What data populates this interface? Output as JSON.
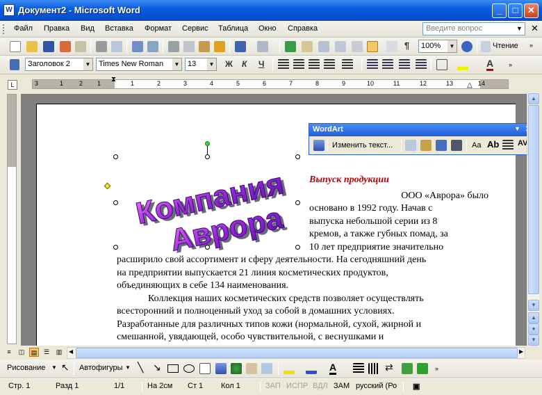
{
  "window": {
    "title": "Документ2 - Microsoft Word",
    "icon": "W"
  },
  "menu": {
    "items": [
      "Файл",
      "Правка",
      "Вид",
      "Вставка",
      "Формат",
      "Сервис",
      "Таблица",
      "Окно",
      "Справка"
    ],
    "ask_placeholder": "Введите вопрос"
  },
  "toolbar_standard": {
    "zoom": "100%",
    "read_label": "Чтение"
  },
  "toolbar_formatting": {
    "style": "Заголовок 2",
    "font": "Times New Roman",
    "size": "13",
    "bold": "Ж",
    "italic": "К",
    "underline": "Ч"
  },
  "ruler": {
    "marks": [
      "3",
      "1",
      "2",
      "1",
      "1",
      "2",
      "3",
      "4",
      "5",
      "6",
      "7",
      "8",
      "9",
      "10",
      "11",
      "12",
      "13",
      "14"
    ]
  },
  "wordart_toolbar": {
    "title": "WordArt",
    "edit_text": "Изменить текст..."
  },
  "wordart": {
    "line1": "Компания",
    "line2": "Аврора"
  },
  "document": {
    "heading": "Выпуск продукции",
    "para1_lines": [
      "ООО «Аврора» было",
      "основано в 1992 году. Начав с",
      "выпуска небольшой серии из 8",
      "кремов, а также губных помад, за",
      "10 лет предприятие значительно"
    ],
    "para1_full_lines": [
      "расширило свой ассортимент и сферу деятельности. На сегодняшний день",
      "на предприятии выпускается 21 линия косметических продуктов,",
      "объединяющих в себе 134 наименования."
    ],
    "para2_lines": [
      "Коллекция наших косметических средств позволяет осуществлять",
      "всесторонний и полноценный уход за собой в домашних условиях.",
      "Разработанные для различных типов кожи (нормальной, сухой, жирной и",
      "смешанной, увядающей, особо чувствительной, с веснушками и"
    ]
  },
  "drawing_toolbar": {
    "draw_label": "Рисование",
    "autoshapes_label": "Автофигуры"
  },
  "status": {
    "page": "Стр. 1",
    "section": "Разд 1",
    "pages": "1/1",
    "at": "На 2см",
    "line": "Ст 1",
    "col": "Кол 1",
    "rec": "ЗАП",
    "trk": "ИСПР",
    "ext": "ВДЛ",
    "ovr": "ЗАМ",
    "lang": "русский (Ро"
  }
}
